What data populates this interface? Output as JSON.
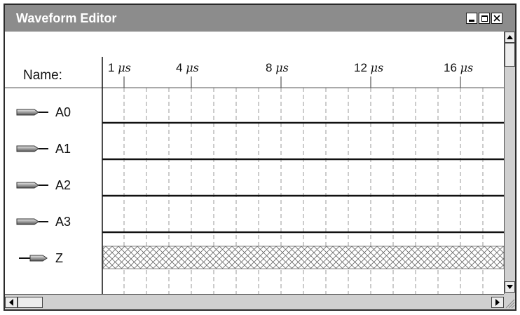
{
  "window": {
    "title": "Waveform Editor"
  },
  "controls": {
    "minimize": "minimize-icon",
    "maximize": "maximize-icon",
    "close": "close-icon"
  },
  "header": {
    "name_label": "Name:"
  },
  "timeline": {
    "unit": "μs",
    "ticks": [
      {
        "value": "1",
        "unit": "μs"
      },
      {
        "value": "4",
        "unit": "μs"
      },
      {
        "value": "8",
        "unit": "μs"
      },
      {
        "value": "12",
        "unit": "μs"
      },
      {
        "value": "16",
        "unit": "μs"
      }
    ]
  },
  "signals": [
    {
      "name": "A0",
      "direction": "input",
      "icon": "input-arrow-icon",
      "state": "low"
    },
    {
      "name": "A1",
      "direction": "input",
      "icon": "input-arrow-icon",
      "state": "low"
    },
    {
      "name": "A2",
      "direction": "input",
      "icon": "input-arrow-icon",
      "state": "low"
    },
    {
      "name": "A3",
      "direction": "input",
      "icon": "input-arrow-icon",
      "state": "low"
    },
    {
      "name": "Z",
      "direction": "output",
      "icon": "output-arrow-icon",
      "state": "undefined"
    }
  ],
  "colors": {
    "titlebar": "#8c8c8c",
    "waveform": "#111111",
    "grid": "#9a9a9a",
    "hatch": "#666666"
  }
}
